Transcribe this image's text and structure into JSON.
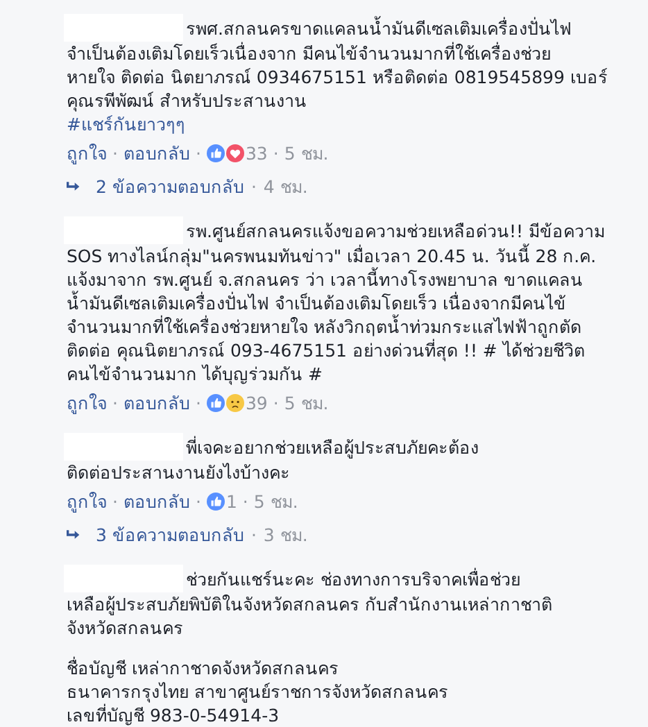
{
  "separator": "·",
  "comments": [
    {
      "name_hidden": true,
      "paragraphs": [
        [
          "รพศ.สกลนครขาดแคลนน้ำมันดีเซลเติมเครื่องปั่นไฟ",
          "จำเป็นต้องเติมโดยเร็วเนื่องจาก มีคนไข้จำนวนมากที่ใช้เครื่องช่วย",
          "หายใจ ติดต่อ นิตยาภรณ์ 0934675151 หรือติดต่อ 0819545899 เบอร์",
          "คุณรพีพัฒน์ สำหรับประสานงาน"
        ]
      ],
      "hashtag": "#แชร์กันยาวๆๆ",
      "actions": {
        "like": "ถูกใจ",
        "reply": "ตอบกลับ",
        "reactions": [
          {
            "kind": "like"
          },
          {
            "kind": "love"
          }
        ],
        "count": "33",
        "time": "5 ชม."
      },
      "replies": {
        "label": "2 ข้อความตอบกลับ",
        "time": "4 ชม."
      }
    },
    {
      "name_hidden": true,
      "paragraphs": [
        [
          "รพ.ศูนย์สกลนครแจ้งขอความช่วยเหลือด่วน!! มีข้อความ",
          "SOS ทางไลน์กลุ่ม\"นครพนมทันข่าว\" เมื่อเวลา 20.45 น. วันนี้ 28 ก.ค.",
          "แจ้งมาจาก รพ.ศูนย์ จ.สกลนคร ว่า เวลานี้ทางโรงพยาบาล ขาดแคลน",
          "น้ำมันดีเซลเติมเครื่องปั่นไฟ จำเป็นต้องเติมโดยเร็ว เนื่องจากมีคนไข้",
          "จำนวนมากที่ใช้เครื่องช่วยหายใจ หลังวิกฤตน้ำท่วมกระแสไฟฟ้าถูกตัด",
          "ติดต่อ คุณนิตยาภรณ์ 093-4675151 อย่างด่วนที่สุด !! # ได้ช่วยชีวิต",
          "คนไข้จำนวนมาก ได้บุญร่วมกัน #"
        ]
      ],
      "actions": {
        "like": "ถูกใจ",
        "reply": "ตอบกลับ",
        "reactions": [
          {
            "kind": "like"
          },
          {
            "kind": "sad"
          }
        ],
        "count": "39",
        "time": "5 ชม."
      }
    },
    {
      "name_hidden": true,
      "paragraphs": [
        [
          "พี่เจคะอยากช่วยเหลือผู้ประสบภัยคะต้อง",
          "ติดต่อประสานงานยังไงบ้างคะ"
        ]
      ],
      "actions": {
        "like": "ถูกใจ",
        "reply": "ตอบกลับ",
        "reactions": [
          {
            "kind": "like"
          }
        ],
        "count": "1",
        "time": "5 ชม."
      },
      "replies": {
        "label": "3 ข้อความตอบกลับ",
        "time": "3 ชม."
      }
    },
    {
      "name_hidden": true,
      "paragraphs": [
        [
          "ช่วยกันแชร์นะคะ ช่องทางการบริจาคเพื่อช่วย",
          "เหลือผู้ประสบภัยพิบัติในจังหวัดสกลนคร กับสำนักงานเหล่ากาชาติ",
          "จังหวัดสกลนคร"
        ],
        [
          "ชื่อบัญชี เหล่ากาชาดจังหวัดสกลนคร",
          "ธนาคารกรุงไทย สาขาศูนย์ราชการจังหวัดสกลนคร",
          "เลขที่บัญชี 983-0-54914-3"
        ]
      ]
    }
  ]
}
